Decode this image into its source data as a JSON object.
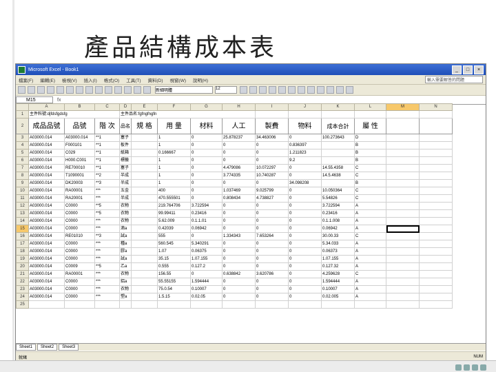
{
  "slide": {
    "title": "產品結構成本表"
  },
  "excel": {
    "window_title": "Microsoft Excel - Book1",
    "menu": [
      "檔案(F)",
      "編輯(E)",
      "檢視(V)",
      "插入(I)",
      "格式(O)",
      "工具(T)",
      "資料(D)",
      "視窗(W)",
      "說明(H)"
    ],
    "help_placeholder": "輸入需要解答的問題",
    "font_name": "新細明體",
    "font_size": "12",
    "name_box": "M15",
    "fx": "fx",
    "columns": [
      "",
      "A",
      "B",
      "C",
      "D",
      "E",
      "F",
      "G",
      "H",
      "I",
      "J",
      "K",
      "L",
      "M",
      "N"
    ],
    "row1": {
      "num": "1",
      "a": "主件料號:djfdsfgdsfg",
      "d": "主件品名:fgfngfngfn"
    },
    "headers": {
      "num": "2",
      "a": "成品品號",
      "b": "品號",
      "c": "階 次",
      "d": "品名",
      "e": "規 格",
      "f": "用 量",
      "g": "材料",
      "h": "人工",
      "i": "製費",
      "j": "物料",
      "k": "成本合計",
      "l": "屬 性"
    },
    "rows": [
      {
        "n": "3",
        "a": "A03000.014",
        "b": "A03000.014",
        "c": "**1",
        "d": "塞子",
        "e": "",
        "f": "1",
        "g": "0",
        "h": "25.878237",
        "i": "34.463006",
        "j": "0",
        "k": "100.273643",
        "l": "D"
      },
      {
        "n": "4",
        "a": "A03000.014",
        "b": "F000101",
        "c": "**1",
        "d": "板件",
        "e": "",
        "f": "1",
        "g": "0",
        "h": "0",
        "i": "0",
        "j": "0.836397",
        "k": "",
        "l": "B"
      },
      {
        "n": "5",
        "a": "A03000.014",
        "b": "C029",
        "c": "**1",
        "d": "紙箱",
        "e": "",
        "f": "0.166667",
        "g": "0",
        "h": "0",
        "i": "0",
        "j": "1.211823",
        "k": "",
        "l": "B"
      },
      {
        "n": "6",
        "a": "A03000.014",
        "b": "H000.C001",
        "c": "**1",
        "d": "標籤",
        "e": "",
        "f": "1",
        "g": "0",
        "h": "0",
        "i": "0",
        "j": "9.2",
        "k": "",
        "l": "B"
      },
      {
        "n": "7",
        "a": "A03000.014",
        "b": "RE700010",
        "c": "**1",
        "d": "塞子",
        "e": "",
        "f": "1",
        "g": "0",
        "h": "4.479086",
        "i": "10.072297",
        "j": "0",
        "k": "14.55.4358",
        "l": "C"
      },
      {
        "n": "8",
        "a": "A03000.014",
        "b": "T1090001",
        "c": "**2",
        "d": "半成",
        "e": "",
        "f": "1",
        "g": "0",
        "h": "3.774335",
        "i": "10.740287",
        "j": "0",
        "k": "14.5.4638",
        "l": "C"
      },
      {
        "n": "9",
        "a": "A03000.014",
        "b": "DK20003",
        "c": "**3",
        "d": "半成",
        "e": "",
        "f": "1",
        "g": "0",
        "h": "0",
        "i": "0",
        "j": "34.098208",
        "k": "",
        "l": "B"
      },
      {
        "n": "10",
        "a": "A03000.014",
        "b": "RA00001",
        "c": "***",
        "d": "五金",
        "e": "",
        "f": "400",
        "g": "0",
        "h": "1.037469",
        "i": "9.025799",
        "j": "0",
        "k": "10.050364",
        "l": "C"
      },
      {
        "n": "11",
        "a": "A03000.014",
        "b": "RA20001",
        "c": "***",
        "d": "半成",
        "e": "",
        "f": "470.555501",
        "g": "0",
        "h": "0.808434",
        "i": "4.738827",
        "j": "0",
        "k": "5.54826",
        "l": "C"
      },
      {
        "n": "12",
        "a": "A03000.014",
        "b": "C0000",
        "c": "**5",
        "d": "衣物",
        "e": "",
        "f": "219.764706",
        "g": "3.722594",
        "h": "0",
        "i": "0",
        "j": "0",
        "k": "3.722594",
        "l": "A"
      },
      {
        "n": "13",
        "a": "A03000.014",
        "b": "C0000",
        "c": "**5",
        "d": "衣物",
        "e": "",
        "f": "99.99411",
        "g": "0.23416",
        "h": "0",
        "i": "0",
        "j": "0",
        "k": "0.23416",
        "l": "A"
      },
      {
        "n": "14",
        "a": "A03000.014",
        "b": "C0000",
        "c": "***",
        "d": "衣物",
        "e": "",
        "f": "5.62.009",
        "g": "0.1.1.01",
        "h": "0",
        "i": "0",
        "j": "0",
        "k": "0.1.1.008",
        "l": "A"
      },
      {
        "n": "15",
        "a": "A03000.014",
        "b": "C0000",
        "c": "***",
        "d": "滴a",
        "e": "",
        "f": "0.42039",
        "g": "0.06942",
        "h": "0",
        "i": "0",
        "j": "0",
        "k": "0.06942",
        "l": "A"
      },
      {
        "n": "16",
        "a": "A03000.014",
        "b": "RE01010",
        "c": "**3",
        "d": "試a",
        "e": "",
        "f": "555",
        "g": "0",
        "h": "1.334343",
        "i": "7.653264",
        "j": "0",
        "k": "30.00.33",
        "l": "C"
      },
      {
        "n": "17",
        "a": "A03000.014",
        "b": "C0000",
        "c": "***",
        "d": "種a",
        "e": "",
        "f": "560.545",
        "g": "5.340291",
        "h": "0",
        "i": "0",
        "j": "0",
        "k": "5.34.033",
        "l": "A"
      },
      {
        "n": "18",
        "a": "A03000.014",
        "b": "C0000",
        "c": "***",
        "d": "膠a",
        "e": "",
        "f": "1.07",
        "g": "0.06375",
        "h": "0",
        "i": "0",
        "j": "0",
        "k": "0.06373",
        "l": "A"
      },
      {
        "n": "19",
        "a": "A03000.014",
        "b": "C0000",
        "c": "***",
        "d": "試a",
        "e": "",
        "f": "35.15",
        "g": "1.07.155",
        "h": "0",
        "i": "0",
        "j": "0",
        "k": "1.07.155",
        "l": "A"
      },
      {
        "n": "20",
        "a": "A03000.014",
        "b": "C0009",
        "c": "**5",
        "d": "乙a",
        "e": "",
        "f": "0.555",
        "g": "0.127.2",
        "h": "0",
        "i": "0",
        "j": "0",
        "k": "0.127.32",
        "l": "A"
      },
      {
        "n": "21",
        "a": "A03000.014",
        "b": "RA00001",
        "c": "***",
        "d": "衣物",
        "e": "",
        "f": "156.55",
        "g": "0",
        "h": "0.638842",
        "i": "3.620786",
        "j": "0",
        "k": "4.259628",
        "l": "C"
      },
      {
        "n": "22",
        "a": "A03000.014",
        "b": "C0000",
        "c": "***",
        "d": "鋁a",
        "e": "",
        "f": "55.55155",
        "g": "1.594444",
        "h": "0",
        "i": "0",
        "j": "0",
        "k": "1.594444",
        "l": "A"
      },
      {
        "n": "23",
        "a": "A03000.014",
        "b": "C0000",
        "c": "***",
        "d": "衣物",
        "e": "",
        "f": "75.0.54",
        "g": "0.10007",
        "h": "0",
        "i": "0",
        "j": "0",
        "k": "0.10007",
        "l": "A"
      },
      {
        "n": "24",
        "a": "A03000.014",
        "b": "C0000",
        "c": "***",
        "d": "塑a",
        "e": "",
        "f": "1.5.15",
        "g": "0.02.05",
        "h": "0",
        "i": "0",
        "j": "0",
        "k": "0.02.005",
        "l": "A"
      },
      {
        "n": "25",
        "a": "",
        "b": "",
        "c": "",
        "d": "",
        "e": "",
        "f": "",
        "g": "",
        "h": "",
        "i": "",
        "j": "",
        "k": "",
        "l": ""
      }
    ],
    "sheets": [
      "Sheet1",
      "Sheet2",
      "Sheet3"
    ],
    "status": "就緒",
    "status_right": "NUM"
  }
}
